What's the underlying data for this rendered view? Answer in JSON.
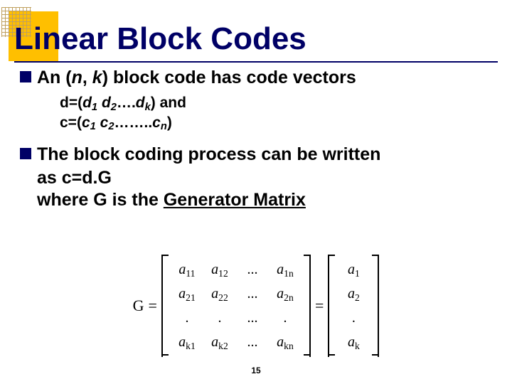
{
  "title": "Linear Block Codes",
  "b1": {
    "pre": "An (",
    "n": "n",
    "comma": ", ",
    "k": "k",
    "post": ") block code has code vectors"
  },
  "sub_d": {
    "pre": "d=(",
    "d": "d",
    "s1": "1",
    "sp": " ",
    "s2": "2",
    "dots": "….",
    "sk": "k",
    "post": ") and"
  },
  "sub_c": {
    "pre": "c=(",
    "c": "c",
    "s1": "1",
    "sp": " ",
    "s2": "2",
    "dots": "……..",
    "sn": "n",
    "post": ")"
  },
  "b2": {
    "line1": "The block coding process can be written",
    "line2a": "as  c=d",
    "line2b": "G",
    "line3a": "where G is the ",
    "line3b": "Generator Matrix"
  },
  "matrix": {
    "G": "G",
    "eq": "=",
    "dotsh": "...",
    "dotv": ".",
    "a": "a",
    "s11": "11",
    "s12": "12",
    "s1n": "1n",
    "s21": "21",
    "s22": "22",
    "s2n": "2n",
    "sk1": "k1",
    "sk2": "k2",
    "skn": "kn",
    "r1": "1",
    "r2": "2",
    "rk": "k"
  },
  "page": "15"
}
